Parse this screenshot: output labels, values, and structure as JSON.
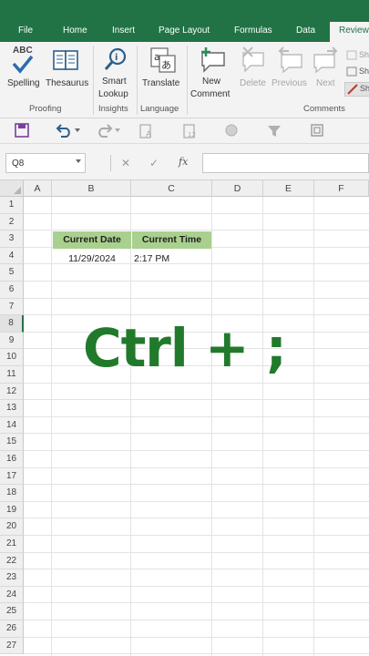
{
  "tabs": [
    "File",
    "Home",
    "Insert",
    "Page Layout",
    "Formulas",
    "Data",
    "Review"
  ],
  "active_tab": "Review",
  "ribbon": {
    "spelling": {
      "icon_text": "ABC",
      "label": "Spelling"
    },
    "thesaurus": "Thesaurus",
    "smart_lookup": [
      "Smart",
      "Lookup"
    ],
    "translate": "Translate",
    "new_comment": [
      "New",
      "Comment"
    ],
    "delete": "Delete",
    "previous": "Previous",
    "next": "Next",
    "side_items": [
      "Sh",
      "Sh",
      "Sh"
    ],
    "groups": [
      "Proofing",
      "Insights",
      "Language",
      "Comments"
    ]
  },
  "name_box": "Q8",
  "formula_value": "",
  "fx_label": "fx",
  "columns": [
    "A",
    "B",
    "C",
    "D",
    "E",
    "F"
  ],
  "rows": [
    "1",
    "2",
    "3",
    "4",
    "5",
    "6",
    "7",
    "8",
    "9",
    "10",
    "11",
    "12",
    "13",
    "14",
    "15",
    "16",
    "17",
    "18",
    "19",
    "20",
    "21",
    "22",
    "23",
    "24",
    "25",
    "26",
    "27"
  ],
  "cells": {
    "b3": "Current Date",
    "c3": "Current Time",
    "b4": "11/29/2024",
    "c4": "2:17 PM"
  },
  "overlay": "Ctrl + ;",
  "colors": {
    "brand_green": "#217346",
    "header_fill": "#a9d08e",
    "overlay_green": "#217a2b"
  }
}
